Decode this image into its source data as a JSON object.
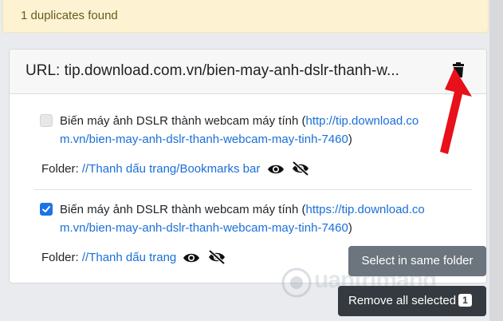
{
  "alert": {
    "text": "1 duplicates found"
  },
  "card": {
    "header_text": "URL: tip.download.com.vn/bien-may-anh-dslr-thanh-w...",
    "delete_icon": "trash-icon",
    "arrow_icon": "red-arrow-annotation"
  },
  "items": [
    {
      "checked": false,
      "title": "Biến máy ảnh DSLR thành webcam máy tính",
      "url_line1": "http://tip.download.co",
      "url_line2": "m.vn/bien-may-anh-dslr-thanh-webcam-may-tinh-7460",
      "open_paren": "(",
      "close_paren": ")",
      "folder_label": "Folder:",
      "folder_path": "//Thanh dấu trang/Bookmarks bar",
      "icons": [
        "eye-icon",
        "eye-slash-icon"
      ]
    },
    {
      "checked": true,
      "title": "Biến máy ảnh DSLR thành webcam máy tính",
      "url_line1": "https://tip.download.co",
      "url_line2": "m.vn/bien-may-anh-dslr-thanh-webcam-may-tinh-7460",
      "open_paren": "(",
      "close_paren": ")",
      "folder_label": "Folder:",
      "folder_path": "//Thanh dấu trang",
      "icons": [
        "eye-icon",
        "eye-slash-icon"
      ]
    }
  ],
  "buttons": {
    "select_same_folder": "Select in same folder",
    "remove_all_selected": "Remove all selected",
    "remove_count": "1"
  },
  "watermark": {
    "text": "uantrimang"
  },
  "colors": {
    "link": "#1a6fd8",
    "checkbox_checked": "#1a73e8",
    "alert_bg": "#fdf3d2",
    "arrow": "#e8101a"
  }
}
